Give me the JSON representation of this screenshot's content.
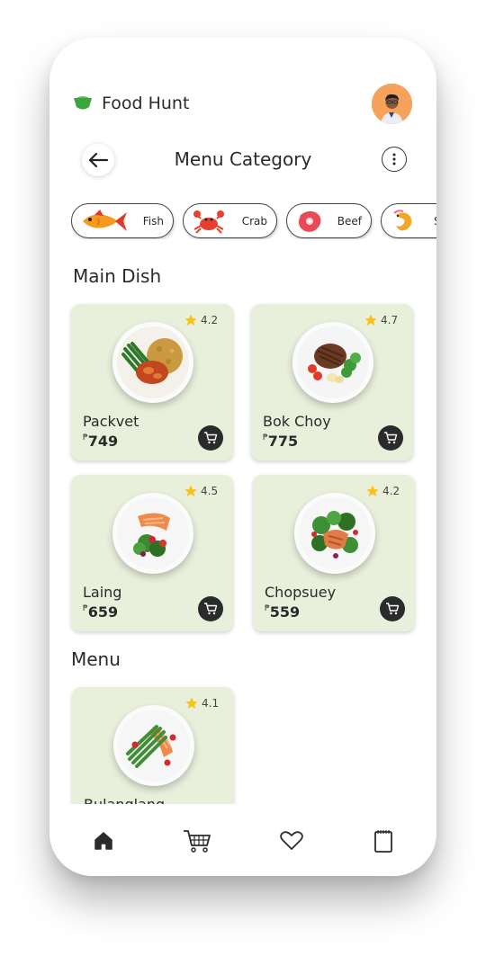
{
  "app": {
    "name": "Food Hunt"
  },
  "header": {
    "title": "Menu Category"
  },
  "categories": [
    {
      "label": "Fish",
      "icon": "fish-icon"
    },
    {
      "label": "Crab",
      "icon": "crab-icon"
    },
    {
      "label": "Beef",
      "icon": "beef-icon"
    },
    {
      "label": "S",
      "icon": "shrimp-icon"
    }
  ],
  "sections": {
    "main": "Main Dish",
    "menu": "Menu"
  },
  "currency_symbol": "₱",
  "main_dishes": [
    {
      "name": "Packvet",
      "price": "749",
      "rating": "4.2"
    },
    {
      "name": "Bok Choy",
      "price": "775",
      "rating": "4.7"
    },
    {
      "name": "Laing",
      "price": "659",
      "rating": "4.5"
    },
    {
      "name": "Chopsuey",
      "price": "559",
      "rating": "4.2"
    }
  ],
  "menu_items": [
    {
      "name": "Bulanglang",
      "rating": "4.1"
    }
  ],
  "bottom_nav": [
    {
      "icon": "home-icon"
    },
    {
      "icon": "cart-icon"
    },
    {
      "icon": "heart-icon"
    },
    {
      "icon": "notepad-icon"
    }
  ],
  "colors": {
    "card_bg": "#e8f0dc",
    "accent_green": "#3aa53a",
    "star": "#f7c21c",
    "avatar_bg": "#f7a25a"
  }
}
